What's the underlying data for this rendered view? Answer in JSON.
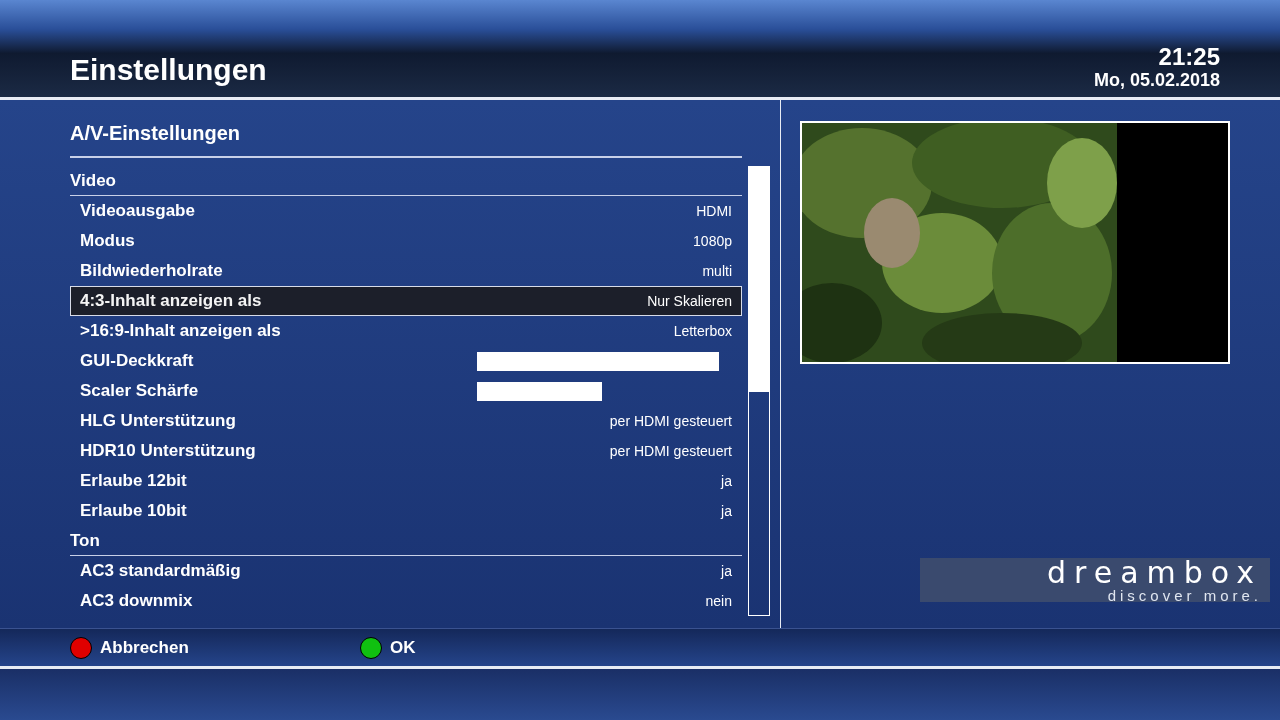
{
  "header": {
    "title": "Einstellungen",
    "time": "21:25",
    "date": "Mo, 05.02.2018"
  },
  "panel": {
    "title": "A/V-Einstellungen"
  },
  "rows": [
    {
      "kind": "section",
      "label": "Video"
    },
    {
      "kind": "text",
      "label": "Videoausgabe",
      "value": "HDMI",
      "selected": false
    },
    {
      "kind": "text",
      "label": "Modus",
      "value": "1080p",
      "selected": false
    },
    {
      "kind": "text",
      "label": "Bildwiederholrate",
      "value": "multi",
      "selected": false
    },
    {
      "kind": "text",
      "label": "4:3-Inhalt anzeigen als",
      "value": "Nur Skalieren",
      "selected": true
    },
    {
      "kind": "text",
      "label": ">16:9-Inhalt anzeigen als",
      "value": "Letterbox",
      "selected": false
    },
    {
      "kind": "slider",
      "label": "GUI-Deckkraft",
      "level": 0.95,
      "selected": false
    },
    {
      "kind": "slider",
      "label": "Scaler Schärfe",
      "level": 0.49,
      "selected": false
    },
    {
      "kind": "text",
      "label": "HLG Unterstützung",
      "value": "per HDMI gesteuert",
      "selected": false
    },
    {
      "kind": "text",
      "label": "HDR10 Unterstützung",
      "value": "per HDMI gesteuert",
      "selected": false
    },
    {
      "kind": "text",
      "label": "Erlaube 12bit",
      "value": "ja",
      "selected": false
    },
    {
      "kind": "text",
      "label": "Erlaube 10bit",
      "value": "ja",
      "selected": false
    },
    {
      "kind": "section",
      "label": "Ton"
    },
    {
      "kind": "text",
      "label": "AC3 standardmäßig",
      "value": "ja",
      "selected": false
    },
    {
      "kind": "text",
      "label": "AC3 downmix",
      "value": "nein",
      "selected": false
    }
  ],
  "logo": {
    "name": "dreambox",
    "slogan": "discover more."
  },
  "buttons": [
    {
      "label": "Abbrechen",
      "color": "#e00000"
    },
    {
      "label": "OK",
      "color": "#10c010"
    }
  ]
}
